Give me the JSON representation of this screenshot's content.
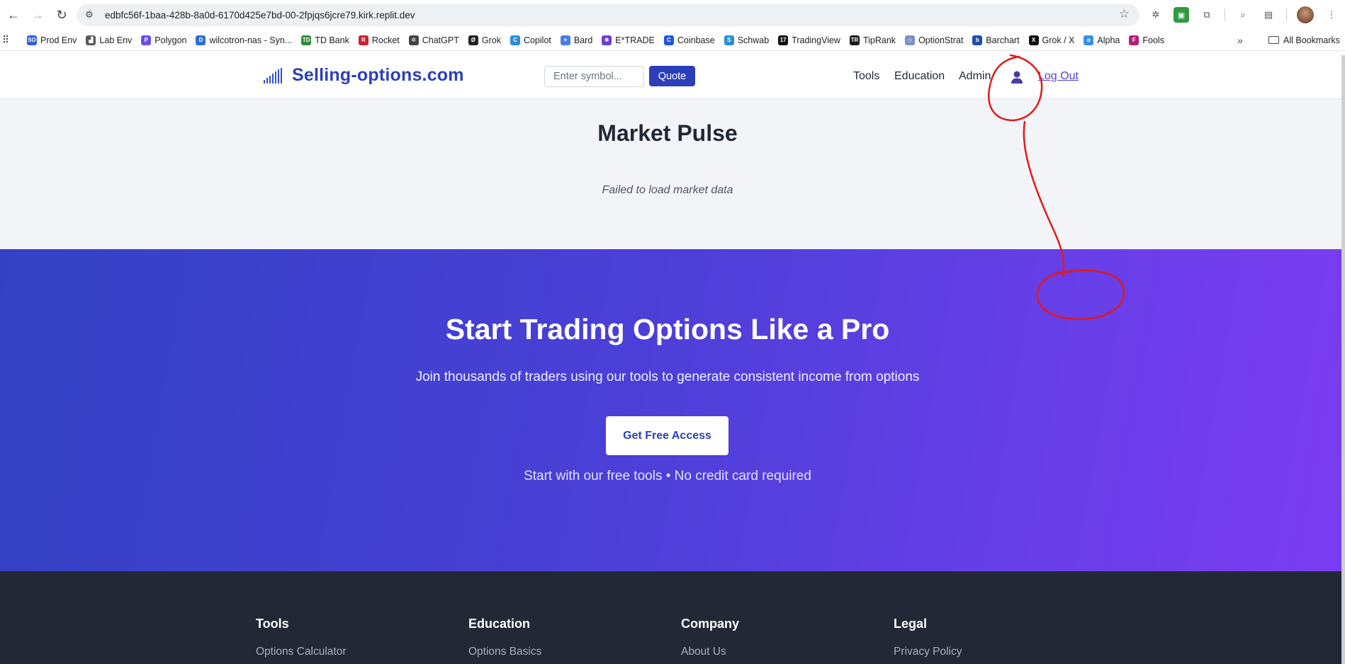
{
  "browser": {
    "url": "edbfc56f-1baa-428b-8a0d-6170d425e7bd-00-2fpjqs6jcre79.kirk.replit.dev",
    "bookmarks": [
      {
        "label": "Prod Env",
        "icon": "so-favicon",
        "color": "#2f5fd6",
        "glyph": "SO"
      },
      {
        "label": "Lab Env",
        "icon": "chart-favicon",
        "color": "#5a5a5a",
        "glyph": "▟"
      },
      {
        "label": "Polygon",
        "icon": "polygon-favicon",
        "color": "#6b4de6",
        "glyph": "P"
      },
      {
        "label": "wilcotron-nas - Syn...",
        "icon": "dsm-favicon",
        "color": "#2d6fd6",
        "glyph": "D"
      },
      {
        "label": "TD Bank",
        "icon": "tdbank-favicon",
        "color": "#2f8a3a",
        "glyph": "TD"
      },
      {
        "label": "Rocket",
        "icon": "rocket-favicon",
        "color": "#c8202f",
        "glyph": "R"
      },
      {
        "label": "ChatGPT",
        "icon": "chatgpt-favicon",
        "color": "#444",
        "glyph": "✲"
      },
      {
        "label": "Grok",
        "icon": "grok-favicon",
        "color": "#222",
        "glyph": "Ø"
      },
      {
        "label": "Copilot",
        "icon": "copilot-favicon",
        "color": "#2a8fd8",
        "glyph": "C"
      },
      {
        "label": "Bard",
        "icon": "bard-favicon",
        "color": "#4a7de8",
        "glyph": "✦"
      },
      {
        "label": "E*TRADE",
        "icon": "etrade-favicon",
        "color": "#6a3fd8",
        "glyph": "✱"
      },
      {
        "label": "Coinbase",
        "icon": "coinbase-favicon",
        "color": "#2155e6",
        "glyph": "C"
      },
      {
        "label": "Schwab",
        "icon": "schwab-favicon",
        "color": "#2a8fd8",
        "glyph": "S"
      },
      {
        "label": "TradingView",
        "icon": "tradingview-favicon",
        "color": "#111",
        "glyph": "17"
      },
      {
        "label": "TipRank",
        "icon": "tiprank-favicon",
        "color": "#1a1a1a",
        "glyph": "TR"
      },
      {
        "label": "OptionStrat",
        "icon": "optionstrat-favicon",
        "color": "#7a8ec9",
        "glyph": "◇"
      },
      {
        "label": "Barchart",
        "icon": "barchart-favicon",
        "color": "#1f4ea8",
        "glyph": "b"
      },
      {
        "label": "Grok / X",
        "icon": "x-favicon",
        "color": "#111",
        "glyph": "X"
      },
      {
        "label": "Alpha",
        "icon": "alpha-favicon",
        "color": "#3a8fe0",
        "glyph": "α"
      },
      {
        "label": "Fools",
        "icon": "fools-favicon",
        "color": "#b3207a",
        "glyph": "F"
      }
    ],
    "all_bookmarks": "All Bookmarks"
  },
  "header": {
    "brand": "Selling-options.com",
    "symbol_placeholder": "Enter symbol...",
    "quote_label": "Quote",
    "nav": {
      "tools": "Tools",
      "education": "Education",
      "admin": "Admin"
    },
    "logout": "Log Out"
  },
  "pulse": {
    "title": "Market Pulse",
    "error": "Failed to load market data"
  },
  "hero": {
    "title": "Start Trading Options Like a Pro",
    "subtitle": "Join thousands of traders using our tools to generate consistent income from options",
    "cta": "Get Free Access",
    "note": "Start with our free tools • No credit card required"
  },
  "footer": {
    "columns": [
      {
        "heading": "Tools",
        "link": "Options Calculator"
      },
      {
        "heading": "Education",
        "link": "Options Basics"
      },
      {
        "heading": "Company",
        "link": "About Us"
      },
      {
        "heading": "Legal",
        "link": "Privacy Policy"
      }
    ]
  },
  "colors": {
    "brand": "#2b3fb8",
    "hero_start": "#3342c4",
    "hero_end": "#7b3cf2",
    "footer_bg": "#222836",
    "annotation": "#e01b1b"
  }
}
